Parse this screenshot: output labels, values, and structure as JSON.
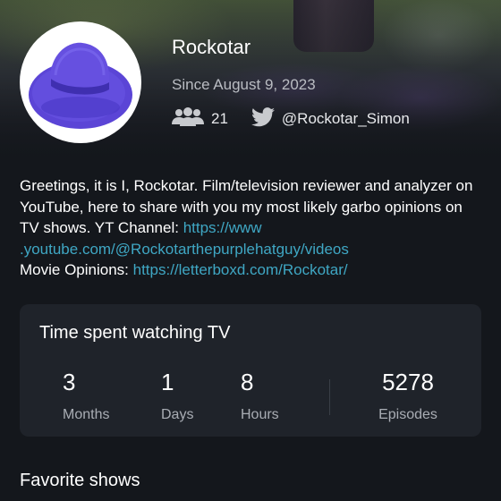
{
  "profile": {
    "name": "Rockotar",
    "since": "Since August 9, 2023",
    "followers": "21",
    "twitter_handle": "@Rockotar_Simon",
    "avatar_icon": "purple-hat-icon"
  },
  "bio": {
    "text1": "Greetings, it is I, Rockotar. Film/television reviewer and analyzer on YouTube, here to share with you my most likely garbo opinions on TV shows. YT Channel: ",
    "youtube_link": "https://www.youtube.com/@Rockotarthepurplehatguy/videos",
    "youtube_link_line1": "https://www",
    "youtube_link_line2": ".youtube.com/@Rockotarthepurplehatguy/videos",
    "text2": "Movie Opinions: ",
    "letterboxd_link": "https://letterboxd.com/Rockotar/"
  },
  "stats": {
    "title": "Time spent watching TV",
    "months_value": "3",
    "months_label": "Months",
    "days_value": "1",
    "days_label": "Days",
    "hours_value": "8",
    "hours_label": "Hours",
    "episodes_value": "5278",
    "episodes_label": "Episodes"
  },
  "sections": {
    "favorite_shows_title": "Favorite shows"
  },
  "colors": {
    "background": "#14171c",
    "card": "#1f232a",
    "link": "#3fa7c4",
    "hat": "#5b45d6",
    "secondary_text": "#b9bcc2"
  }
}
